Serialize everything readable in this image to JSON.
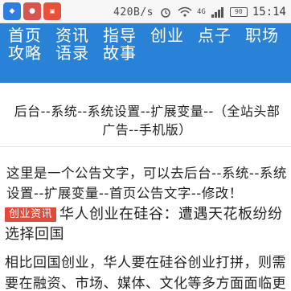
{
  "statusbar": {
    "app_icons": [
      "app-icon-1",
      "app-icon-2",
      "app-icon-3"
    ],
    "net_speed": "420B/s",
    "network": "4G",
    "battery": "90",
    "time": "15:14"
  },
  "nav": {
    "items": [
      {
        "label": "首页"
      },
      {
        "label": "资讯"
      },
      {
        "label": "指导"
      },
      {
        "label": "创业"
      },
      {
        "label": "点子"
      },
      {
        "label": "职场"
      },
      {
        "label": "攻略"
      },
      {
        "label": "语录"
      },
      {
        "label": "故事"
      }
    ],
    "bg_color": "#2a82d6"
  },
  "page_title": "后台--系统--系统设置--扩展变量--（全站头部广告--手机版）",
  "notice": "这里是一个公告文字，可以去后台--系统--系统设置--扩展变量--首页公告文字--修改！",
  "article": {
    "tag": "创业资讯",
    "title": "华人创业在硅谷：遭遇天花板纷纷选择回国",
    "body": "相比回国创业，华人要在硅谷创业打拼，则需要在融资、市场、媒体、文化等多方面面临更"
  }
}
